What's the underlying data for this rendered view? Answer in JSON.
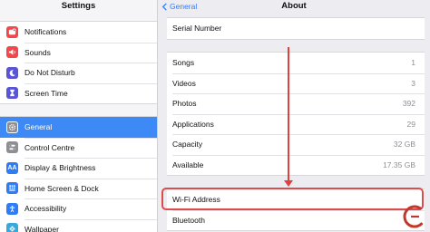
{
  "left": {
    "title": "Settings",
    "groups": [
      {
        "items": [
          {
            "label": "Notifications",
            "icon": "notifications-icon",
            "color": "#f2484b"
          },
          {
            "label": "Sounds",
            "icon": "sounds-icon",
            "color": "#f2484b"
          },
          {
            "label": "Do Not Disturb",
            "icon": "moon-icon",
            "color": "#5a55d6"
          },
          {
            "label": "Screen Time",
            "icon": "hourglass-icon",
            "color": "#5a55d6"
          }
        ]
      },
      {
        "items": [
          {
            "label": "General",
            "icon": "gear-icon",
            "color": "#8e8e93",
            "selected": true
          },
          {
            "label": "Control Centre",
            "icon": "toggles-icon",
            "color": "#8e8e93"
          },
          {
            "label": "Display & Brightness",
            "icon": "aa-icon",
            "color": "#2f7cf6"
          },
          {
            "label": "Home Screen & Dock",
            "icon": "grid-icon",
            "color": "#2f7cf6"
          },
          {
            "label": "Accessibility",
            "icon": "accessibility-icon",
            "color": "#2f7cf6"
          },
          {
            "label": "Wallpaper",
            "icon": "flower-icon",
            "color": "#35aadc"
          }
        ]
      }
    ]
  },
  "right": {
    "back_label": "General",
    "title": "About",
    "serial": {
      "label": "Serial Number",
      "value": ""
    },
    "stats": [
      {
        "label": "Songs",
        "value": "1"
      },
      {
        "label": "Videos",
        "value": "3"
      },
      {
        "label": "Photos",
        "value": "392"
      },
      {
        "label": "Applications",
        "value": "29"
      },
      {
        "label": "Capacity",
        "value": "32 GB"
      },
      {
        "label": "Available",
        "value": "17.35 GB"
      }
    ],
    "network": [
      {
        "label": "Wi-Fi Address",
        "value": ""
      },
      {
        "label": "Bluetooth",
        "value": ""
      }
    ]
  },
  "annotation_color": "#e0413c"
}
